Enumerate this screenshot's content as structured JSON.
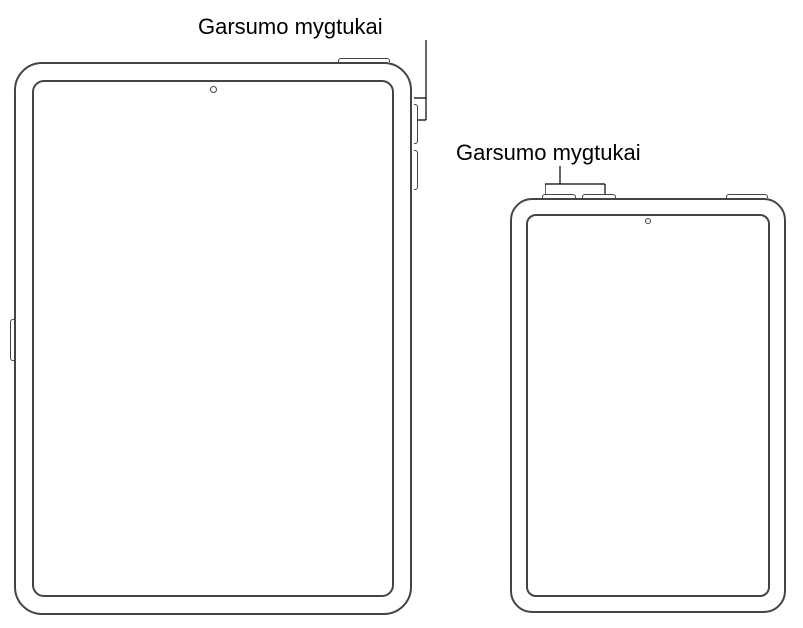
{
  "labels": {
    "ipad_pro_volume": "Garsumo mygtukai",
    "ipad_mini_volume": "Garsumo mygtukai"
  }
}
